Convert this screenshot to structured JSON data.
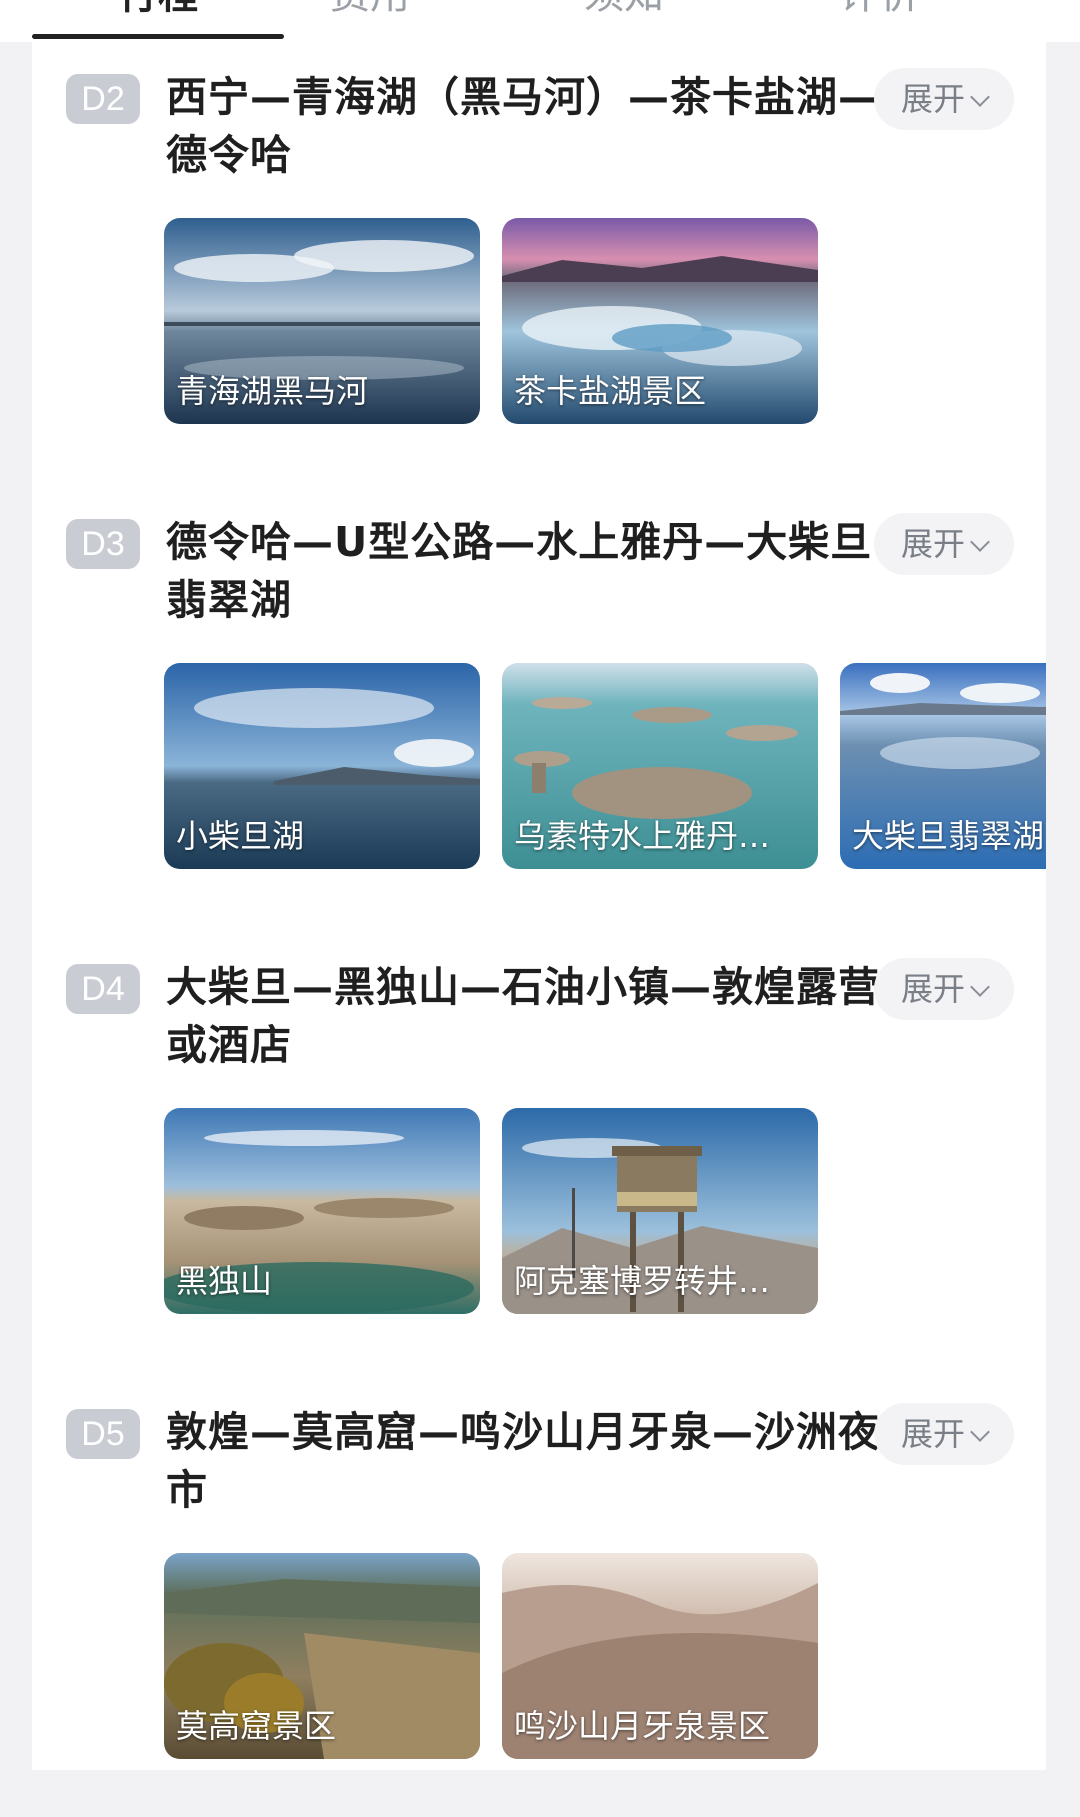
{
  "tabs": [
    {
      "label": "行程",
      "active": true
    },
    {
      "label": "费用",
      "active": false
    },
    {
      "label": "须知",
      "active": false
    },
    {
      "label": "评价",
      "active": false
    }
  ],
  "expand_label": "展开",
  "days": [
    {
      "badge": "D2",
      "title": "西宁—青海湖（黑马河）—茶卡盐湖—德令哈",
      "photos": [
        {
          "label": "青海湖黑马河",
          "scene": "lake-clouds"
        },
        {
          "label": "茶卡盐湖景区",
          "scene": "salt-lake-dusk"
        }
      ]
    },
    {
      "badge": "D3",
      "title": "德令哈—U型公路—水上雅丹—大柴旦翡翠湖",
      "photos": [
        {
          "label": "小柴旦湖",
          "scene": "lake-sky"
        },
        {
          "label": "乌素特水上雅丹…",
          "scene": "yardang-water"
        },
        {
          "label": "大柴旦翡翠湖",
          "scene": "emerald-lake"
        }
      ]
    },
    {
      "badge": "D4",
      "title": "大柴旦—黑独山—石油小镇—敦煌露营或酒店",
      "photos": [
        {
          "label": "黑独山",
          "scene": "black-mountain"
        },
        {
          "label": "阿克塞博罗转井…",
          "scene": "watchtower"
        }
      ]
    },
    {
      "badge": "D5",
      "title": "敦煌—莫高窟—鸣沙山月牙泉—沙洲夜市",
      "photos": [
        {
          "label": "莫高窟景区",
          "scene": "mogao-cliffs"
        },
        {
          "label": "鸣沙山月牙泉景区",
          "scene": "sand-dunes"
        }
      ]
    }
  ]
}
